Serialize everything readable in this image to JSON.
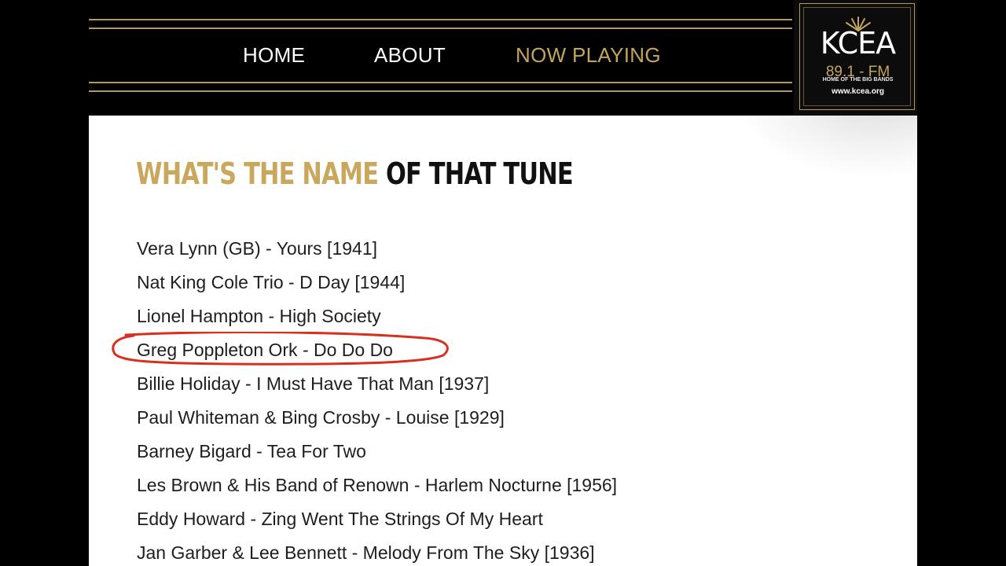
{
  "nav": {
    "items": [
      {
        "label": "HOME",
        "active": false
      },
      {
        "label": "ABOUT",
        "active": false
      },
      {
        "label": "NOW PLAYING",
        "active": true
      }
    ]
  },
  "logo": {
    "word": "KCEA",
    "frequency": "89.1 - FM",
    "tagline": "HOME OF THE BIG BANDS",
    "url": "www.kcea.org"
  },
  "page": {
    "heading_gold": "What's the Name",
    "heading_dark": "of That Tune"
  },
  "tracks": [
    "Vera Lynn (GB) - Yours [1941]",
    "Nat King Cole Trio - D Day [1944]",
    "Lionel Hampton - High Society",
    "Greg Poppleton Ork - Do Do Do",
    "Billie Holiday - I Must Have That Man [1937]",
    "Paul Whiteman & Bing Crosby - Louise [1929]",
    "Barney Bigard - Tea For Two",
    "Les Brown & His Band of Renown - Harlem Nocturne [1956]",
    "Eddy Howard - Zing Went The Strings Of My Heart",
    "Jan Garber & Lee Bennett - Melody From The Sky [1936]"
  ],
  "highlighted_track_index": 3,
  "colors": {
    "accent_gold": "#c4a55d",
    "annotation_red": "#d8301f",
    "nav_background": "#000000"
  }
}
